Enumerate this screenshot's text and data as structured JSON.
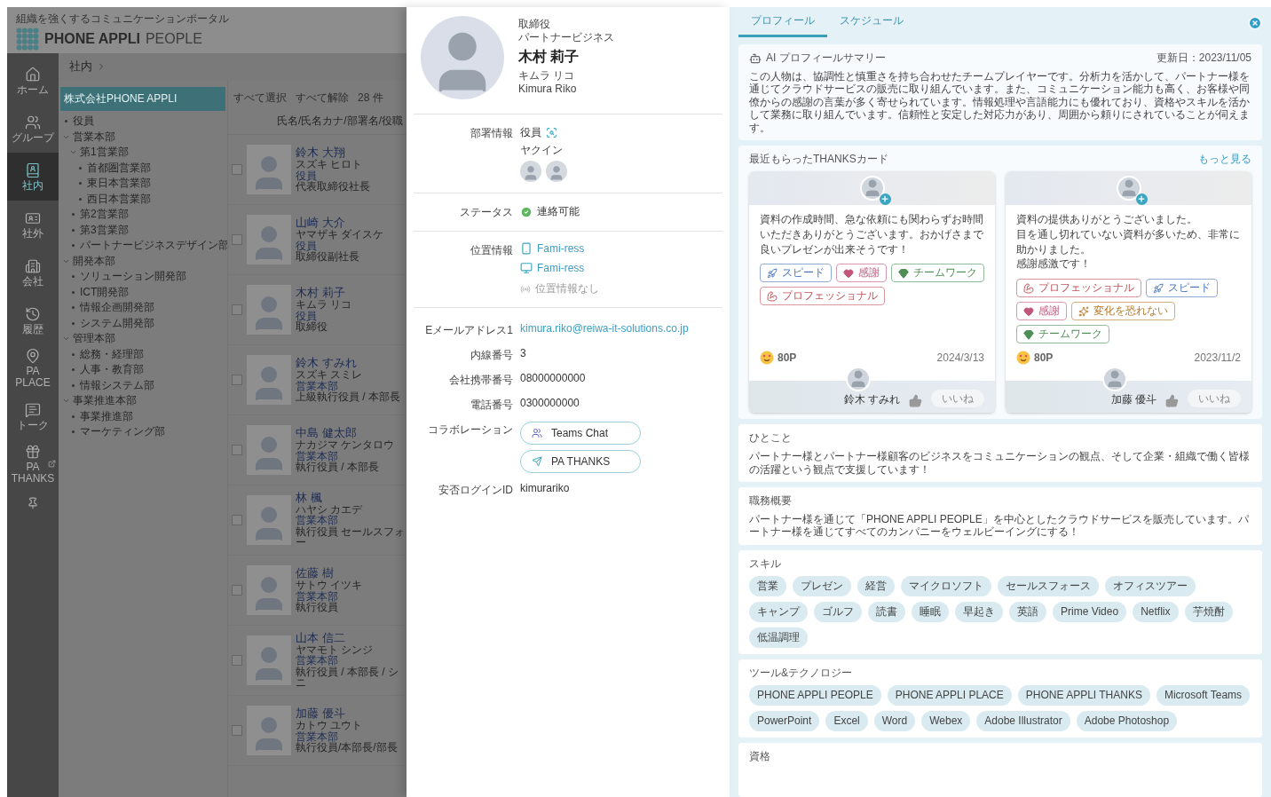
{
  "app": {
    "tagline": "組織を強くするコミュニケーションポータル",
    "brand": "PHONE APPLI",
    "product": "PEOPLE"
  },
  "nav": [
    {
      "kind": "home",
      "label": "ホーム",
      "selected": false
    },
    {
      "kind": "group",
      "label": "グループ",
      "selected": false
    },
    {
      "kind": "internal",
      "label": "社内",
      "selected": true
    },
    {
      "kind": "external",
      "label": "社外",
      "selected": false
    },
    {
      "kind": "company",
      "label": "会社",
      "selected": false
    },
    {
      "kind": "history",
      "label": "履歴",
      "selected": false
    },
    {
      "kind": "place",
      "label": "PA PLACE",
      "selected": false
    },
    {
      "kind": "talk",
      "label": "トーク",
      "selected": false
    },
    {
      "kind": "thanks",
      "label": "PA THANKS",
      "selected": false
    }
  ],
  "breadcrumb": "社内",
  "tree": {
    "root": {
      "label": "株式会社PHONE APPLI",
      "selected": true
    },
    "items": [
      {
        "label": "役員",
        "selected": false
      },
      {
        "label": "営業本部",
        "selected": false,
        "expanded": true,
        "children": [
          {
            "label": "第1営業部",
            "selected": false,
            "expanded": true,
            "children": [
              {
                "label": "首都圏営業部",
                "selected": false
              },
              {
                "label": "東日本営業部",
                "selected": false
              },
              {
                "label": "西日本営業部",
                "selected": false
              }
            ]
          },
          {
            "label": "第2営業部",
            "selected": false
          },
          {
            "label": "第3営業部",
            "selected": false
          },
          {
            "label": "パートナービジネスデザイン部",
            "selected": false
          }
        ]
      },
      {
        "label": "開発本部",
        "selected": false,
        "expanded": true,
        "children": [
          {
            "label": "ソリューション開発部",
            "selected": false
          },
          {
            "label": "ICT開発部",
            "selected": false
          },
          {
            "label": "情報企画開発部",
            "selected": false
          },
          {
            "label": "システム開発部",
            "selected": false
          }
        ]
      },
      {
        "label": "管理本部",
        "selected": false,
        "expanded": true,
        "children": [
          {
            "label": "総務・経理部",
            "selected": false
          },
          {
            "label": "人事・教育部",
            "selected": false
          },
          {
            "label": "情報システム部",
            "selected": false
          }
        ]
      },
      {
        "label": "事業推進本部",
        "selected": false,
        "expanded": true,
        "children": [
          {
            "label": "事業推進部",
            "selected": false
          },
          {
            "label": "マーケティング部",
            "selected": false
          }
        ]
      }
    ]
  },
  "list": {
    "select_all": "すべて選択",
    "deselect_all": "すべて解除",
    "count": "28 件",
    "sort_label": "氏名/氏名カナ/部署名/役職",
    "people": [
      {
        "name": "鈴木 大翔",
        "kana": "スズキ ヒロト",
        "dept": "役員",
        "title": "代表取締役社長",
        "checked": false
      },
      {
        "name": "山崎 大介",
        "kana": "ヤマザキ ダイスケ",
        "dept": "役員",
        "title": "取締役副社長",
        "checked": false
      },
      {
        "name": "木村 莉子",
        "kana": "キムラ リコ",
        "dept": "役員",
        "title": "取締役",
        "checked": false
      },
      {
        "name": "鈴木 すみれ",
        "kana": "スズキ スミレ",
        "dept": "営業本部",
        "title": "上級執行役員 / 本部長",
        "checked": false
      },
      {
        "name": "中島 健太郎",
        "kana": "ナカジマ ケンタロウ",
        "dept": "営業本部",
        "title": "執行役員 / 本部長",
        "checked": false
      },
      {
        "name": "林 楓",
        "kana": "ハヤシ カエデ",
        "dept": "営業本部",
        "title": "執行役員 セールスフォー",
        "checked": false
      },
      {
        "name": "佐藤 樹",
        "kana": "サトウ イツキ",
        "dept": "営業本部",
        "title": "執行役員",
        "checked": false
      },
      {
        "name": "山本 信二",
        "kana": "ヤマモト シンジ",
        "dept": "営業本部",
        "title": "執行役員 / 本部長 / シニ",
        "checked": false
      },
      {
        "name": "加藤 優斗",
        "kana": "カトウ ユウト",
        "dept": "営業本部",
        "title": "執行役員/本部長/部長",
        "checked": false
      }
    ]
  },
  "profile": {
    "title": "取締役",
    "unit": "パートナービジネス",
    "name": "木村 莉子",
    "kana": "キムラ リコ",
    "roman": "Kimura Riko",
    "department": {
      "label": "部署情報",
      "value": "役員",
      "reading": "ヤクイン"
    },
    "status": {
      "label": "ステータス",
      "value": "連絡可能"
    },
    "location": {
      "label": "位置情報",
      "places": [
        {
          "kind": "mobile",
          "text": "Fami-ress"
        },
        {
          "kind": "pc",
          "text": "Fami-ress"
        },
        {
          "kind": "none",
          "text": "位置情報なし"
        }
      ]
    },
    "contacts": [
      {
        "kind": "link",
        "label": "Eメールアドレス1",
        "value": "kimura.riko@reiwa-it-solutions.co.jp"
      },
      {
        "kind": "text",
        "label": "内線番号",
        "value": "3"
      },
      {
        "kind": "text",
        "label": "会社携帯番号",
        "value": "08000000000"
      },
      {
        "kind": "text",
        "label": "電話番号",
        "value": "0300000000"
      }
    ],
    "collaboration": {
      "label": "コラボレーション",
      "buttons": [
        {
          "kind": "teams",
          "label": "Teams Chat"
        },
        {
          "kind": "thanks",
          "label": "PA THANKS"
        }
      ]
    },
    "login": {
      "label": "安否ログインID",
      "value": "kimurariko"
    }
  },
  "detail": {
    "tabs": [
      {
        "label": "プロフィール",
        "selected": true
      },
      {
        "label": "スケジュール",
        "selected": false
      }
    ],
    "ai_summary": {
      "title": "AI プロフィールサマリー",
      "updated": "更新日：2023/11/05",
      "text": "この人物は、協調性と慎重さを持ち合わせたチームプレイヤーです。分析力を活かして、パートナー様を通じてクラウドサービスの販売に取り組んでいます。また、コミュニケーション能力も高く、お客様や同僚からの感謝の言葉が多く寄せられています。情報処理や言語能力にも優れており、資格やスキルを活かして業務に取り組んでいます。信頼性と安定した対応力があり、周囲から頼りにされていることが伺えます。"
    },
    "thanks": {
      "title": "最近もらったTHANKSカード",
      "more": "もっと見る",
      "cards": [
        {
          "lines": [
            "資料の作成時間、急な依頼にも関わらずお時間いただきありがとうございます。おかげさまで良いプレゼンが出来そうです！"
          ],
          "tags": [
            {
              "kind": "speed",
              "label": "スピード"
            },
            {
              "kind": "thanks",
              "label": "感謝"
            },
            {
              "kind": "teamwork",
              "label": "チームワーク"
            },
            {
              "kind": "professional",
              "label": "プロフェッショナル"
            }
          ],
          "points": "80P",
          "date": "2024/3/13",
          "sender": "鈴木 すみれ",
          "like": "いいね"
        },
        {
          "lines": [
            "資料の提供ありがとうございました。",
            "目を通し切れていない資料が多いため、非常に助かりました。",
            "感謝感激です！"
          ],
          "tags": [
            {
              "kind": "professional",
              "label": "プロフェッショナル"
            },
            {
              "kind": "speed",
              "label": "スピード"
            },
            {
              "kind": "thanks",
              "label": "感謝"
            },
            {
              "kind": "change",
              "label": "変化を恐れない"
            },
            {
              "kind": "teamwork",
              "label": "チームワーク"
            }
          ],
          "points": "80P",
          "date": "2023/11/2",
          "sender": "加藤 優斗",
          "like": "いいね"
        }
      ]
    },
    "sections": [
      {
        "kind": "text",
        "title": "ひとこと",
        "text": "パートナー様とパートナー様顧客のビジネスをコミュニケーションの観点、そして企業・組織で働く皆様の活躍という観点で支援しています！"
      },
      {
        "kind": "text",
        "title": "職務概要",
        "text": "パートナー様を通じて「PHONE APPLI PEOPLE」を中心としたクラウドサービスを販売しています。パートナー様を通じてすべてのカンパニーをウェルビーイングにする！"
      },
      {
        "kind": "chips",
        "title": "スキル",
        "chips": [
          "営業",
          "プレゼン",
          "経営",
          "マイクロソフト",
          "セールスフォース",
          "オフィスツアー",
          "キャンプ",
          "ゴルフ",
          "読書",
          "睡眠",
          "早起き",
          "英語",
          "Prime Video",
          "Netflix",
          "芋焼酎",
          "低温調理"
        ]
      },
      {
        "kind": "chips",
        "title": "ツール&テクノロジー",
        "chips": [
          "PHONE APPLI PEOPLE",
          "PHONE APPLI PLACE",
          "PHONE APPLI THANKS",
          "Microsoft Teams",
          "PowerPoint",
          "Excel",
          "Word",
          "Webex",
          "Adobe Illustrator",
          "Adobe Photoshop"
        ]
      },
      {
        "kind": "heading",
        "title": "資格"
      }
    ]
  }
}
